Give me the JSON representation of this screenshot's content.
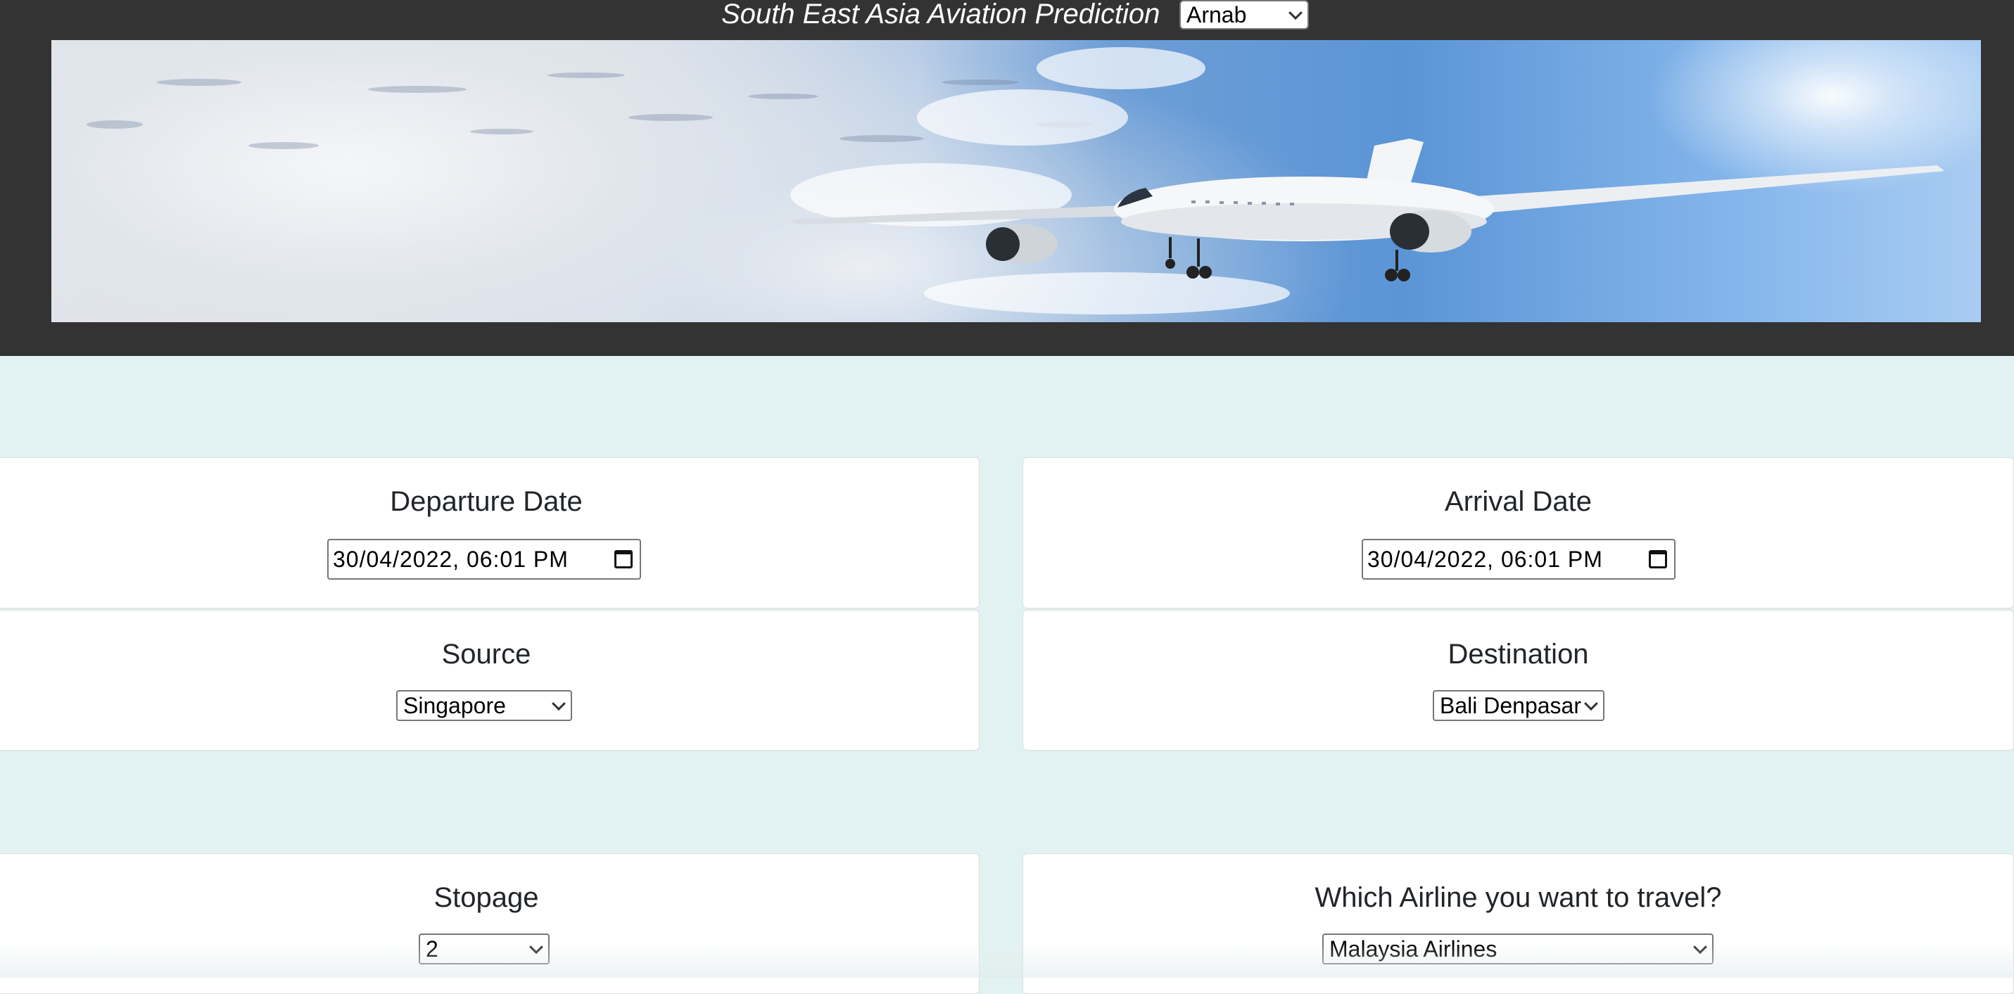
{
  "header": {
    "title": "South East Asia Aviation Prediction",
    "user_select": {
      "value": "Arnab"
    }
  },
  "banner": {
    "image_icon": "airplane-in-sky-image"
  },
  "form": {
    "departure": {
      "label": "Departure Date",
      "value": "30/04/2022, 06:01 PM"
    },
    "arrival": {
      "label": "Arrival Date",
      "value": "30/04/2022, 06:01 PM"
    },
    "source": {
      "label": "Source",
      "value": "Singapore"
    },
    "destination": {
      "label": "Destination",
      "value": "Bali Denpasar"
    },
    "stopage": {
      "label": "Stopage",
      "value": "2"
    },
    "airline": {
      "label": "Which Airline you want to travel?",
      "value": "Malaysia Airlines"
    }
  },
  "colors": {
    "header_bg": "#333333",
    "page_bg": "#e2f2f2",
    "card_bg": "#ffffff"
  }
}
